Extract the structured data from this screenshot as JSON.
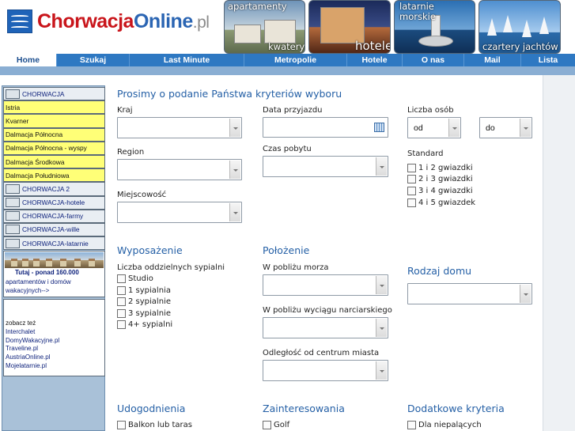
{
  "header": {
    "logo_part1": "Chorwacja",
    "logo_part2": "Online",
    "logo_part3": ".pl",
    "banners": [
      {
        "top": "apartamenty",
        "bottom": "kwatery"
      },
      {
        "top": "",
        "bottom": "hotele"
      },
      {
        "top": "latarnie\nmorskie",
        "bottom": ""
      },
      {
        "top": "",
        "bottom": "czartery jachtów"
      }
    ]
  },
  "nav": {
    "items": [
      "Home",
      "Szukaj",
      "Last Minute",
      "Metropolie",
      "Hotele",
      "O nas",
      "Mail",
      "Lista"
    ]
  },
  "sidebar": {
    "items": [
      {
        "label": "CHORWACJA",
        "kind": "country"
      },
      {
        "label": "Istria",
        "kind": "region"
      },
      {
        "label": "Kvarner",
        "kind": "region"
      },
      {
        "label": "Dalmacja Północna",
        "kind": "region"
      },
      {
        "label": "Dalmacja Północna - wyspy",
        "kind": "region"
      },
      {
        "label": "Dalmacja Środkowa",
        "kind": "region"
      },
      {
        "label": "Dalmacja Południowa",
        "kind": "region"
      },
      {
        "label": "CHORWACJA 2",
        "kind": "country"
      },
      {
        "label": "CHORWACJA-hotele",
        "kind": "country"
      },
      {
        "label": "CHORWACJA-farmy",
        "kind": "country"
      },
      {
        "label": "CHORWACJA-wille",
        "kind": "country"
      },
      {
        "label": "CHORWACJA-latarnie",
        "kind": "country"
      }
    ],
    "promo_title": "Tutaj - ponad 160.000",
    "promo_text": "apartamentów i domów wakacyjnych-->",
    "see_also": "zobacz też",
    "links": [
      "Interchalet",
      "DomyWakacyjne.pl",
      "Traveline.pl",
      "AustriaOnline.pl",
      "Mojelatarnie.pl"
    ]
  },
  "form": {
    "heading": "Prosimy o podanie Państwa kryteriów wyboru",
    "kraj_label": "Kraj",
    "region_label": "Region",
    "miejscowosc_label": "Miejscowość",
    "data_label": "Data przyjazdu",
    "czas_label": "Czas pobytu",
    "liczba_label": "Liczba osób",
    "od_value": "od",
    "do_value": "do",
    "standard_label": "Standard",
    "standard_options": [
      "1 i 2 gwiazdki",
      "2 i 3 gwiazdki",
      "3 i 4 gwiazdki",
      "4 i 5 gwiazdek"
    ],
    "wyposazenie_title": "Wyposażenie",
    "sypialnie_label": "Liczba oddzielnych sypialni",
    "sypialnie_options": [
      "Studio",
      "1 sypialnia",
      "2 sypialnie",
      "3 sypialnie",
      "4+ sypialni"
    ],
    "polozenie_title": "Położenie",
    "morze_label": "W pobliżu morza",
    "wyciag_label": "W pobliżu wyciągu narciarskiego",
    "centrum_label": "Odległość od centrum miasta",
    "rodzaj_title": "Rodzaj domu",
    "udogodnienia_title": "Udogodnienia",
    "udogodnienia_first": "Balkon lub taras",
    "zainteresowania_title": "Zainteresowania",
    "zainteresowania_first": "Golf",
    "dodatkowe_title": "Dodatkowe kryteria",
    "dodatkowe_first": "Dla niepalących"
  }
}
